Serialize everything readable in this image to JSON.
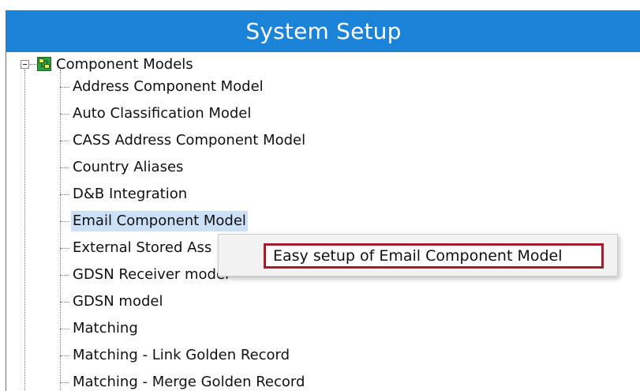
{
  "window": {
    "title": "System Setup"
  },
  "tree": {
    "root": {
      "label": "Component Models",
      "icon": "component-models-icon"
    },
    "children": [
      {
        "label": "Address Component Model"
      },
      {
        "label": "Auto Classification Model"
      },
      {
        "label": "CASS Address Component Model"
      },
      {
        "label": "Country Aliases"
      },
      {
        "label": "D&B Integration"
      },
      {
        "label": "Email Component Model",
        "selected": true
      },
      {
        "label": "External Stored Ass"
      },
      {
        "label": "GDSN Receiver model"
      },
      {
        "label": "GDSN model"
      },
      {
        "label": "Matching"
      },
      {
        "label": "Matching - Link Golden Record"
      },
      {
        "label": "Matching - Merge Golden Record"
      }
    ]
  },
  "context_menu": {
    "items": [
      {
        "label": "Easy setup of Email Component Model",
        "highlighted": true
      }
    ]
  },
  "colors": {
    "titlebar": "#1c84d8",
    "selection": "#cce0f7",
    "highlight_border": "#a51d2d"
  }
}
